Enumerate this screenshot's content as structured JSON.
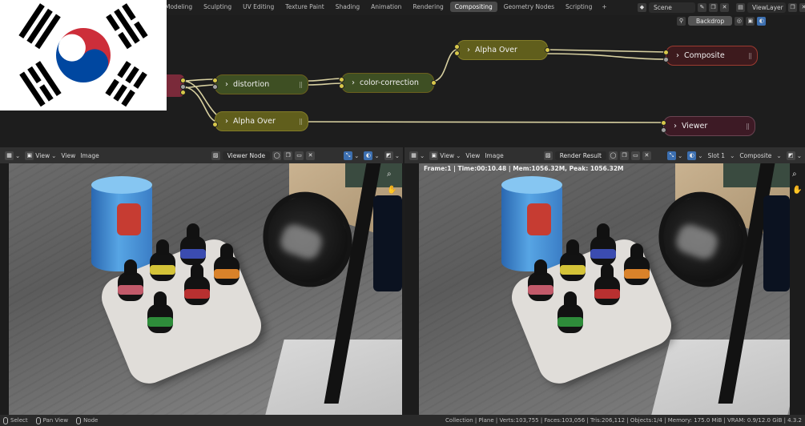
{
  "workspace_tabs": [
    "Modeling",
    "Sculpting",
    "UV Editing",
    "Texture Paint",
    "Shading",
    "Animation",
    "Rendering",
    "Compositing",
    "Geometry Nodes",
    "Scripting"
  ],
  "active_tab": "Compositing",
  "add_workspace": "+",
  "scene": {
    "name": "Scene",
    "view_layer": "ViewLayer"
  },
  "node_editor": {
    "backdrop_label": "Backdrop",
    "nodes": {
      "alpha_over_top": "Alpha Over",
      "composite": "Composite",
      "distortion": "distortion",
      "color_correction": "color-correction",
      "alpha_over_bottom": "Alpha Over",
      "viewer": "Viewer"
    }
  },
  "left_viewer": {
    "menu": {
      "view_select": "View",
      "view": "View",
      "image": "Image"
    },
    "image_name": "Viewer Node"
  },
  "right_viewer": {
    "menu": {
      "view_select": "View",
      "view": "View",
      "image": "Image"
    },
    "image_name": "Render Result",
    "slot": "Slot 1",
    "layer": "Composite",
    "frame_info": "Frame:1 | Time:00:10.48 | Mem:1056.32M, Peak: 1056.32M"
  },
  "statusbar": {
    "select": "Select",
    "pan": "Pan View",
    "node": "Node",
    "stats": "Collection | Plane | Verts:103,755 | Faces:103,056 | Tris:206,112 | Objects:1/4 | Memory: 175.0 MiB | VRAM: 0.9/12.0 GiB | 4.3.2"
  },
  "colors": {
    "flag_red": "#cd2e3a",
    "flag_blue": "#0047a0",
    "node_olive": "#605e1c",
    "node_green": "#3e4f23",
    "node_output": "#3d1a1d",
    "wire": "#d8d0a0"
  },
  "icons": [
    "magnifier-icon",
    "hand-icon",
    "pin-icon",
    "close-icon",
    "image-browse-icon"
  ]
}
